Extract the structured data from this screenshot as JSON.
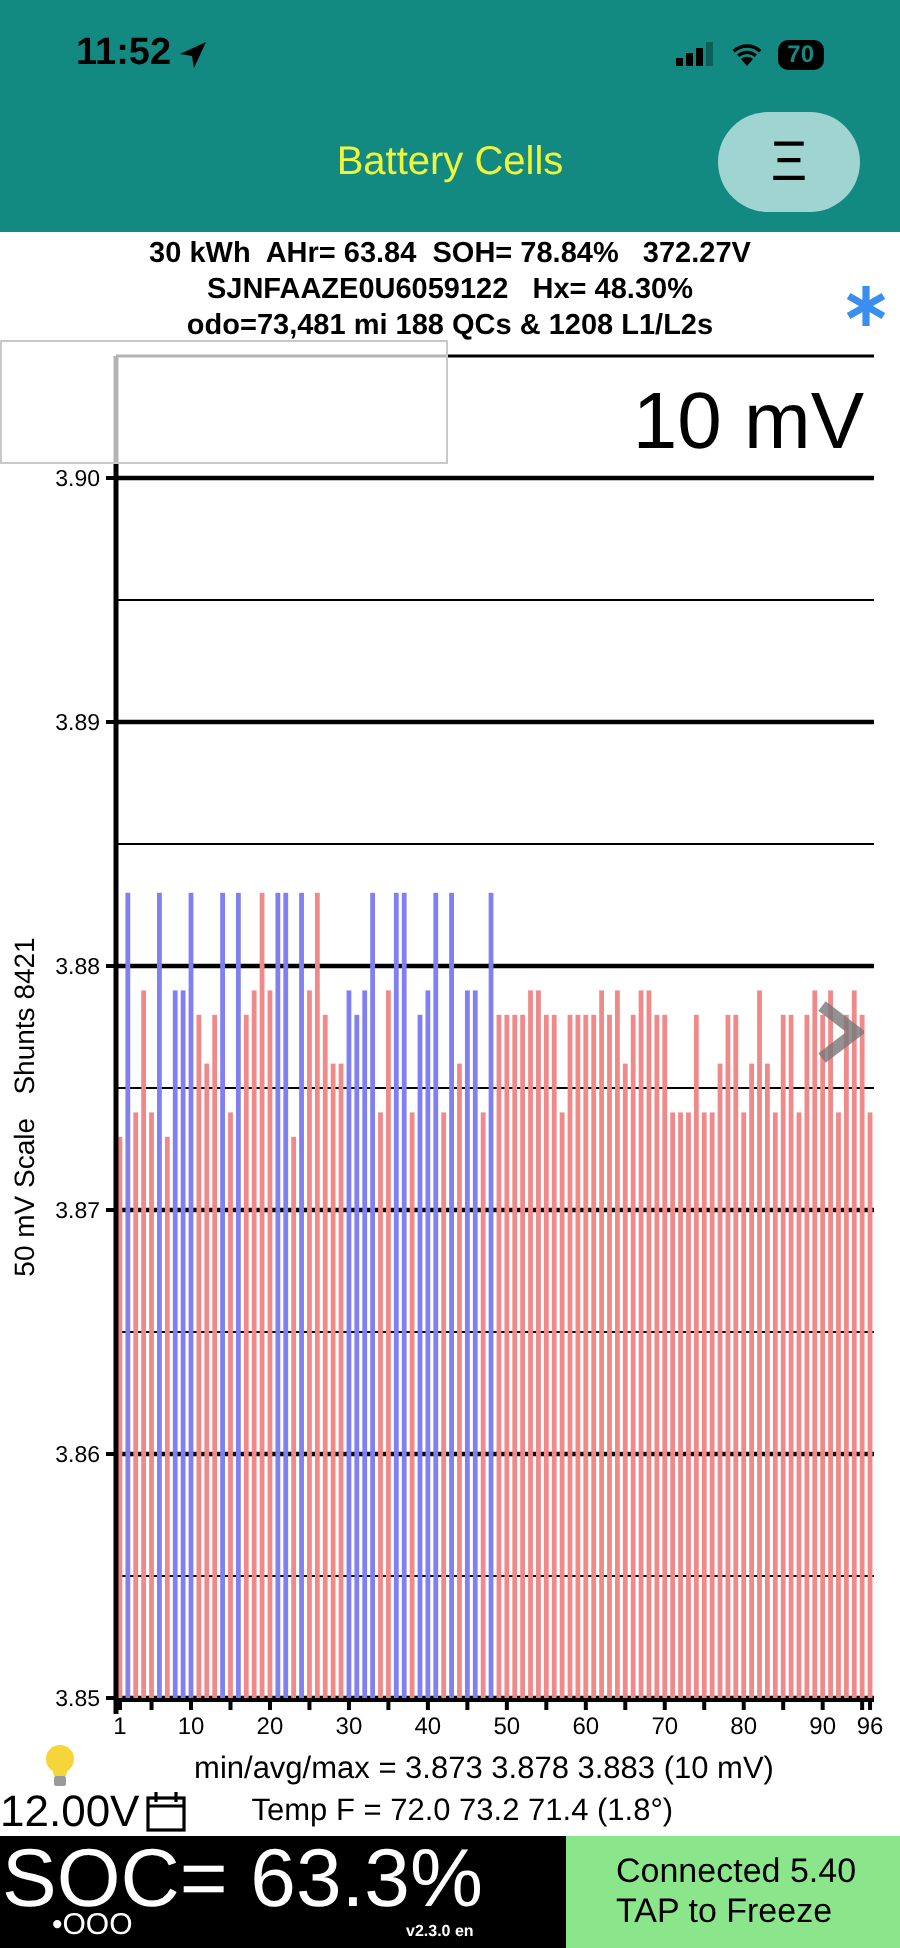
{
  "status_bar": {
    "time": "11:52",
    "battery": "70"
  },
  "header": {
    "title": "Battery Cells",
    "menu_button": "Ξ"
  },
  "info_lines": [
    "30 kWh  AHr= 63.84  SOH= 78.84%   372.27V",
    "SJNFAAZE0U6059122   Hx= 48.30%",
    "odo=73,481 mi 188 QCs & 1208 L1/L2s"
  ],
  "chart": {
    "scale_label": "10 mV",
    "chart_data": {
      "type": "bar",
      "ylabel": "50 mV Scale   Shunts 8421",
      "grid": true,
      "xlim": [
        0.5,
        96.5
      ],
      "x": [
        1,
        2,
        3,
        4,
        5,
        6,
        7,
        8,
        9,
        10,
        11,
        12,
        13,
        14,
        15,
        16,
        17,
        18,
        19,
        20,
        21,
        22,
        23,
        24,
        25,
        26,
        27,
        28,
        29,
        30,
        31,
        32,
        33,
        34,
        35,
        36,
        37,
        38,
        39,
        40,
        41,
        42,
        43,
        44,
        45,
        46,
        47,
        48,
        49,
        50,
        51,
        52,
        53,
        54,
        55,
        56,
        57,
        58,
        59,
        60,
        61,
        62,
        63,
        64,
        65,
        66,
        67,
        68,
        69,
        70,
        71,
        72,
        73,
        74,
        75,
        76,
        77,
        78,
        79,
        80,
        81,
        82,
        83,
        84,
        85,
        86,
        87,
        88,
        89,
        90,
        91,
        92,
        93,
        94,
        95,
        96
      ],
      "series": [
        {
          "color": "#f08a8a",
          "values": [
            3.873,
            null,
            3.874,
            3.879,
            3.874,
            null,
            3.873,
            null,
            null,
            null,
            3.878,
            3.876,
            3.878,
            null,
            3.874,
            null,
            3.878,
            3.879,
            3.883,
            3.879,
            null,
            null,
            3.873,
            null,
            3.879,
            3.883,
            3.878,
            3.876,
            3.876,
            null,
            null,
            null,
            null,
            3.874,
            3.879,
            null,
            null,
            3.874,
            null,
            null,
            null,
            3.874,
            null,
            3.876,
            null,
            null,
            3.874,
            null,
            3.878,
            3.878,
            3.878,
            3.878,
            3.879,
            3.879,
            3.878,
            3.878,
            3.874,
            3.878,
            3.878,
            3.878,
            3.878,
            3.879,
            3.878,
            3.879,
            3.876,
            3.878,
            3.879,
            3.879,
            3.878,
            3.878,
            3.874,
            3.874,
            3.874,
            3.878,
            3.874,
            3.874,
            3.876,
            3.878,
            3.878,
            3.874,
            3.876,
            3.879,
            3.876,
            3.874,
            3.878,
            3.878,
            3.874,
            3.878,
            3.879,
            3.878,
            3.879,
            3.874,
            3.878,
            3.879,
            3.878,
            3.874
          ]
        },
        {
          "color": "#8080f0",
          "values": [
            null,
            3.883,
            null,
            null,
            null,
            3.883,
            null,
            3.879,
            3.879,
            3.883,
            null,
            null,
            null,
            3.883,
            null,
            3.883,
            null,
            null,
            null,
            null,
            3.883,
            3.883,
            null,
            3.883,
            null,
            null,
            null,
            null,
            null,
            3.879,
            3.878,
            3.879,
            3.883,
            null,
            null,
            3.883,
            3.883,
            null,
            3.878,
            3.879,
            3.883,
            null,
            3.883,
            null,
            3.879,
            3.879,
            null,
            3.883,
            null,
            null,
            null,
            null,
            null,
            null,
            null,
            null,
            null,
            null,
            null,
            null,
            null,
            null,
            null,
            null,
            null,
            null,
            null,
            null,
            null,
            null,
            null,
            null,
            null,
            null,
            null,
            null,
            null,
            null,
            null,
            null,
            null,
            null,
            null,
            null,
            null,
            null,
            null,
            null,
            null,
            null,
            null,
            null,
            null,
            null,
            null,
            null
          ]
        }
      ],
      "ylim": [
        3.85,
        3.905
      ],
      "yticks": [
        {
          "value": 3.85,
          "label": "3.85"
        },
        {
          "value": 3.86,
          "label": "3.86"
        },
        {
          "value": 3.87,
          "label": "3.87"
        },
        {
          "value": 3.88,
          "label": "3.88"
        },
        {
          "value": 3.89,
          "label": "3.89"
        },
        {
          "value": 3.9,
          "label": "3.90"
        }
      ],
      "xticks": [
        1,
        10,
        20,
        30,
        40,
        50,
        60,
        70,
        80,
        90,
        96
      ]
    }
  },
  "footer": {
    "aux_battery": "12.00V",
    "stats": "min/avg/max = 3.873 3.878 3.883  (10 mV)",
    "temps": "Temp F = 72.0  73.2  71.4  (1.8°)"
  },
  "soc": {
    "value": "SOC= 63.3%",
    "dots": "•OOO",
    "version": "v2.3.0 en"
  },
  "connection": {
    "lines": [
      "Connected 5.40",
      "TAP to Freeze"
    ]
  }
}
